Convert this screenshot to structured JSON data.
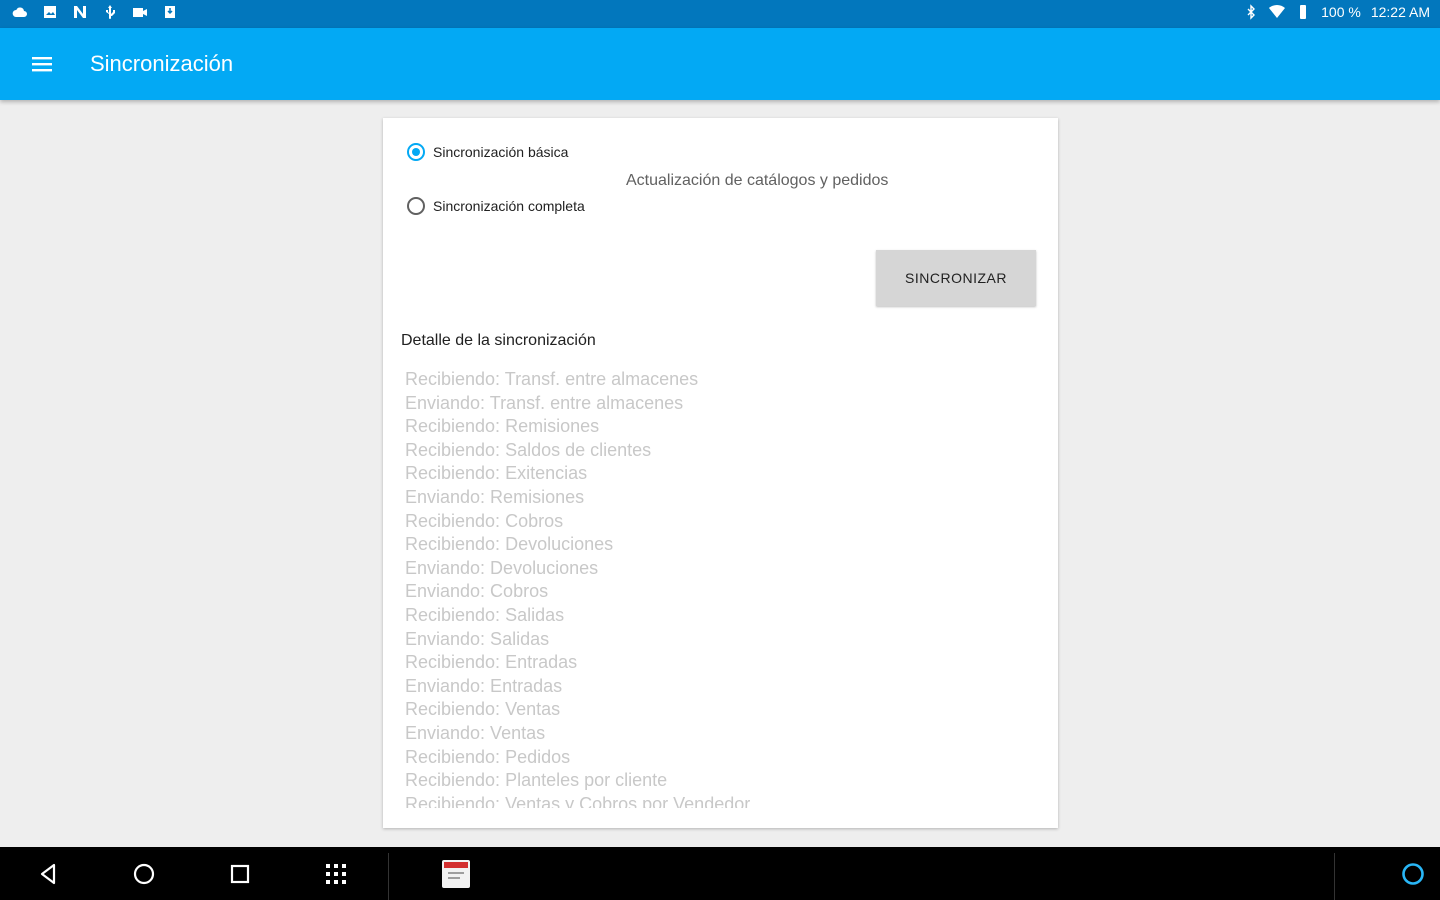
{
  "status_bar": {
    "battery_text": "100 %",
    "time": "12:22 AM",
    "left_icons": [
      "cloud-icon",
      "image-icon",
      "n-icon",
      "usb-icon",
      "video-icon",
      "download-icon"
    ],
    "right_icons": [
      "bluetooth-icon",
      "wifi-icon",
      "battery-icon"
    ]
  },
  "app_bar": {
    "title": "Sincronización",
    "menu_icon": "menu-icon",
    "color": "#03a9f4"
  },
  "sync_options": {
    "basic_label": "Sincronización básica",
    "full_label": "Sincronización completa",
    "selected": "basic",
    "description": "Actualización de catálogos y pedidos"
  },
  "sync_button_label": "SINCRONIZAR",
  "detail": {
    "title": "Detalle de la sincronización",
    "log": [
      "Recibiendo: Transf. entre almacenes",
      "Enviando: Transf. entre almacenes",
      "Recibiendo: Remisiones",
      "Recibiendo: Saldos de clientes",
      "Recibiendo: Exitencias",
      "Enviando: Remisiones",
      "Recibiendo: Cobros",
      "Recibiendo: Devoluciones",
      "Enviando: Devoluciones",
      "Enviando: Cobros",
      "Recibiendo: Salidas",
      "Enviando: Salidas",
      "Recibiendo: Entradas",
      "Enviando: Entradas",
      "Recibiendo: Ventas",
      "Enviando: Ventas",
      "Recibiendo: Pedidos",
      "Recibiendo: Planteles por cliente",
      "Recibiendo: Ventas y Cobros por Vendedor"
    ]
  },
  "nav_bar": {
    "icons": [
      "back-icon",
      "home-icon",
      "recents-icon",
      "app-grid-icon",
      "pinned-app-icon",
      "alexa-icon"
    ]
  }
}
